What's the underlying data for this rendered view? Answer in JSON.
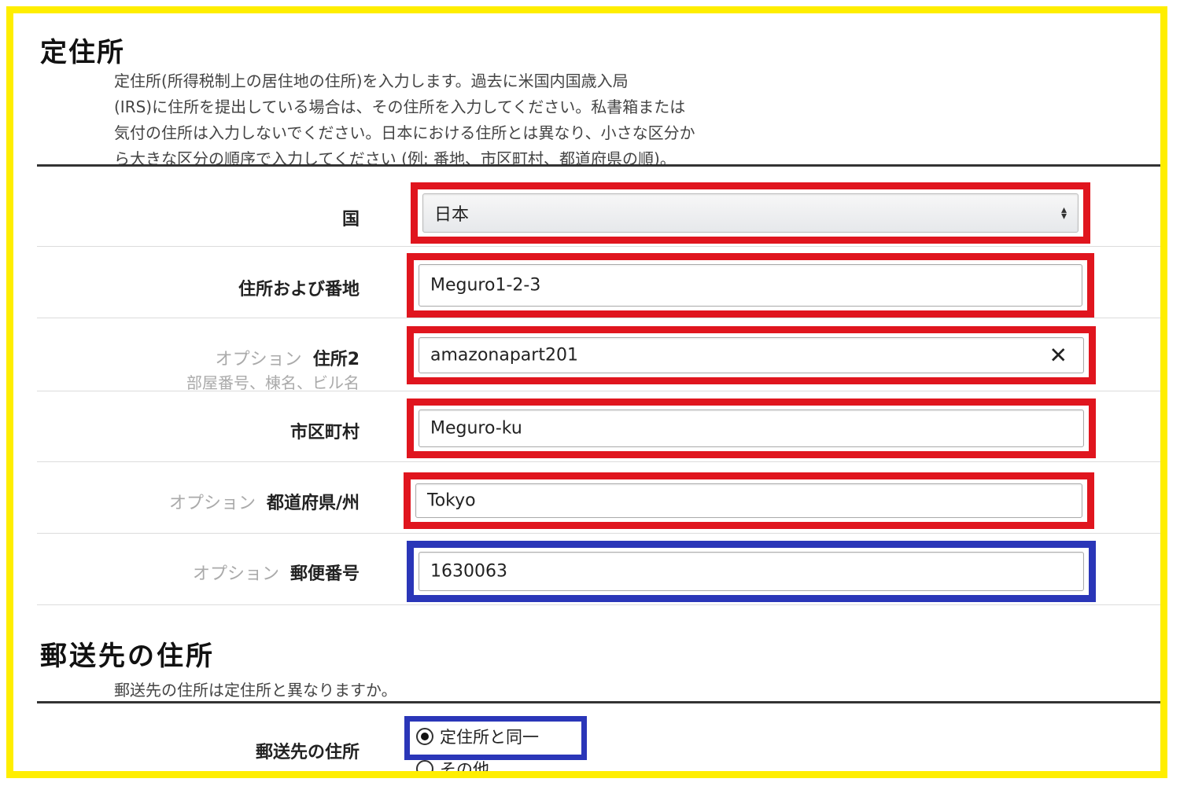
{
  "section1": {
    "title": "定住所",
    "description": "定住所(所得税制上の居住地の住所)を入力します。過去に米国内国歳入局\n(IRS)に住所を提出している場合は、その住所を入力してください。私書箱または\n気付の住所は入力しないでください。日本における住所とは異なり、小さな区分か\nら大きな区分の順序で入力してください (例: 番地、市区町村、都道府県の順)。"
  },
  "fields": {
    "country": {
      "label": "国",
      "value": "日本"
    },
    "address1": {
      "label": "住所および番地",
      "value": "Meguro1-2-3"
    },
    "address2": {
      "optional": "オプション",
      "label": "住所2",
      "hint": "部屋番号、棟名、ビル名",
      "value": "amazonapart201"
    },
    "city": {
      "label": "市区町村",
      "value": "Meguro-ku"
    },
    "state": {
      "optional": "オプション",
      "label": "都道府県/州",
      "value": "Tokyo"
    },
    "postal": {
      "optional": "オプション",
      "label": "郵便番号",
      "value": "1630063"
    }
  },
  "section2": {
    "title": "郵送先の住所",
    "description": "郵送先の住所は定住所と異なりますか。",
    "field_label": "郵送先の住所",
    "options": [
      "定住所と同一",
      "その他"
    ],
    "selected": "定住所と同一"
  },
  "colors": {
    "outer_highlight": "#ffee00",
    "field_highlight_red": "#e0151e",
    "field_highlight_blue": "#2a36b8"
  }
}
